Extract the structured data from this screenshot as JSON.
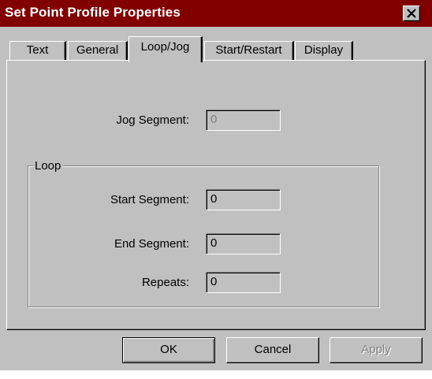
{
  "window": {
    "title": "Set Point Profile Properties",
    "close_icon": "close-icon"
  },
  "tabs": [
    {
      "label": "Text",
      "active": false
    },
    {
      "label": "General",
      "active": false
    },
    {
      "label": "Loop/Jog",
      "active": true
    },
    {
      "label": "Start/Restart",
      "active": false
    },
    {
      "label": "Display",
      "active": false
    }
  ],
  "jog": {
    "label": "Jog Segment:",
    "value": "0",
    "disabled": true
  },
  "loop": {
    "legend": "Loop",
    "start_label": "Start Segment:",
    "start_value": "0",
    "end_label": "End Segment:",
    "end_value": "0",
    "repeats_label": "Repeats:",
    "repeats_value": "0"
  },
  "buttons": {
    "ok": "OK",
    "cancel": "Cancel",
    "apply": "Apply"
  },
  "colors": {
    "titlebar": "#800000",
    "face": "#c0c0c0"
  }
}
